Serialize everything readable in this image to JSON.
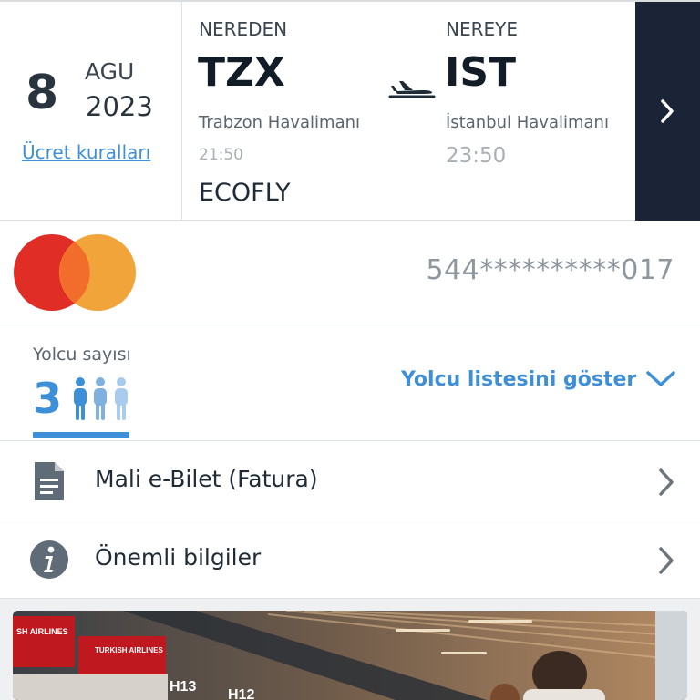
{
  "flight": {
    "day": "8",
    "month": "AGU",
    "year": "2023",
    "fare_rules_link": "Ücret kuralları",
    "origin": {
      "label": "NEREDEN",
      "code": "TZX",
      "airport": "Trabzon Havalimanı",
      "time": "21:50"
    },
    "destination": {
      "label": "NEREYE",
      "code": "IST",
      "airport": "İstanbul Havalimanı",
      "time": "23:50"
    },
    "fare_brand": "ECOFLY",
    "plane_icon": "plane-icon",
    "next_icon": "chevron-right-icon"
  },
  "payment": {
    "card_brand_icon": "mastercard-logo",
    "card_number": "544**********017"
  },
  "passengers": {
    "label": "Yolcu sayısı",
    "count": "3",
    "show_list_link": "Yolcu listesini göster",
    "expand_icon": "chevron-down-icon"
  },
  "menu": [
    {
      "label": "Mali e-Bilet (Fatura)",
      "icon": "document-icon"
    },
    {
      "label": "Önemli bilgiler",
      "icon": "info-icon"
    }
  ],
  "banner": {
    "signs": [
      "SH AIRLINES",
      "TURKISH AIRLINES",
      "H13",
      "H12"
    ]
  },
  "colors": {
    "accent": "#3d8fd7",
    "dark_panel": "#1b2436",
    "mastercard_red": "#e02d26",
    "mastercard_orange": "#f0a43a"
  }
}
